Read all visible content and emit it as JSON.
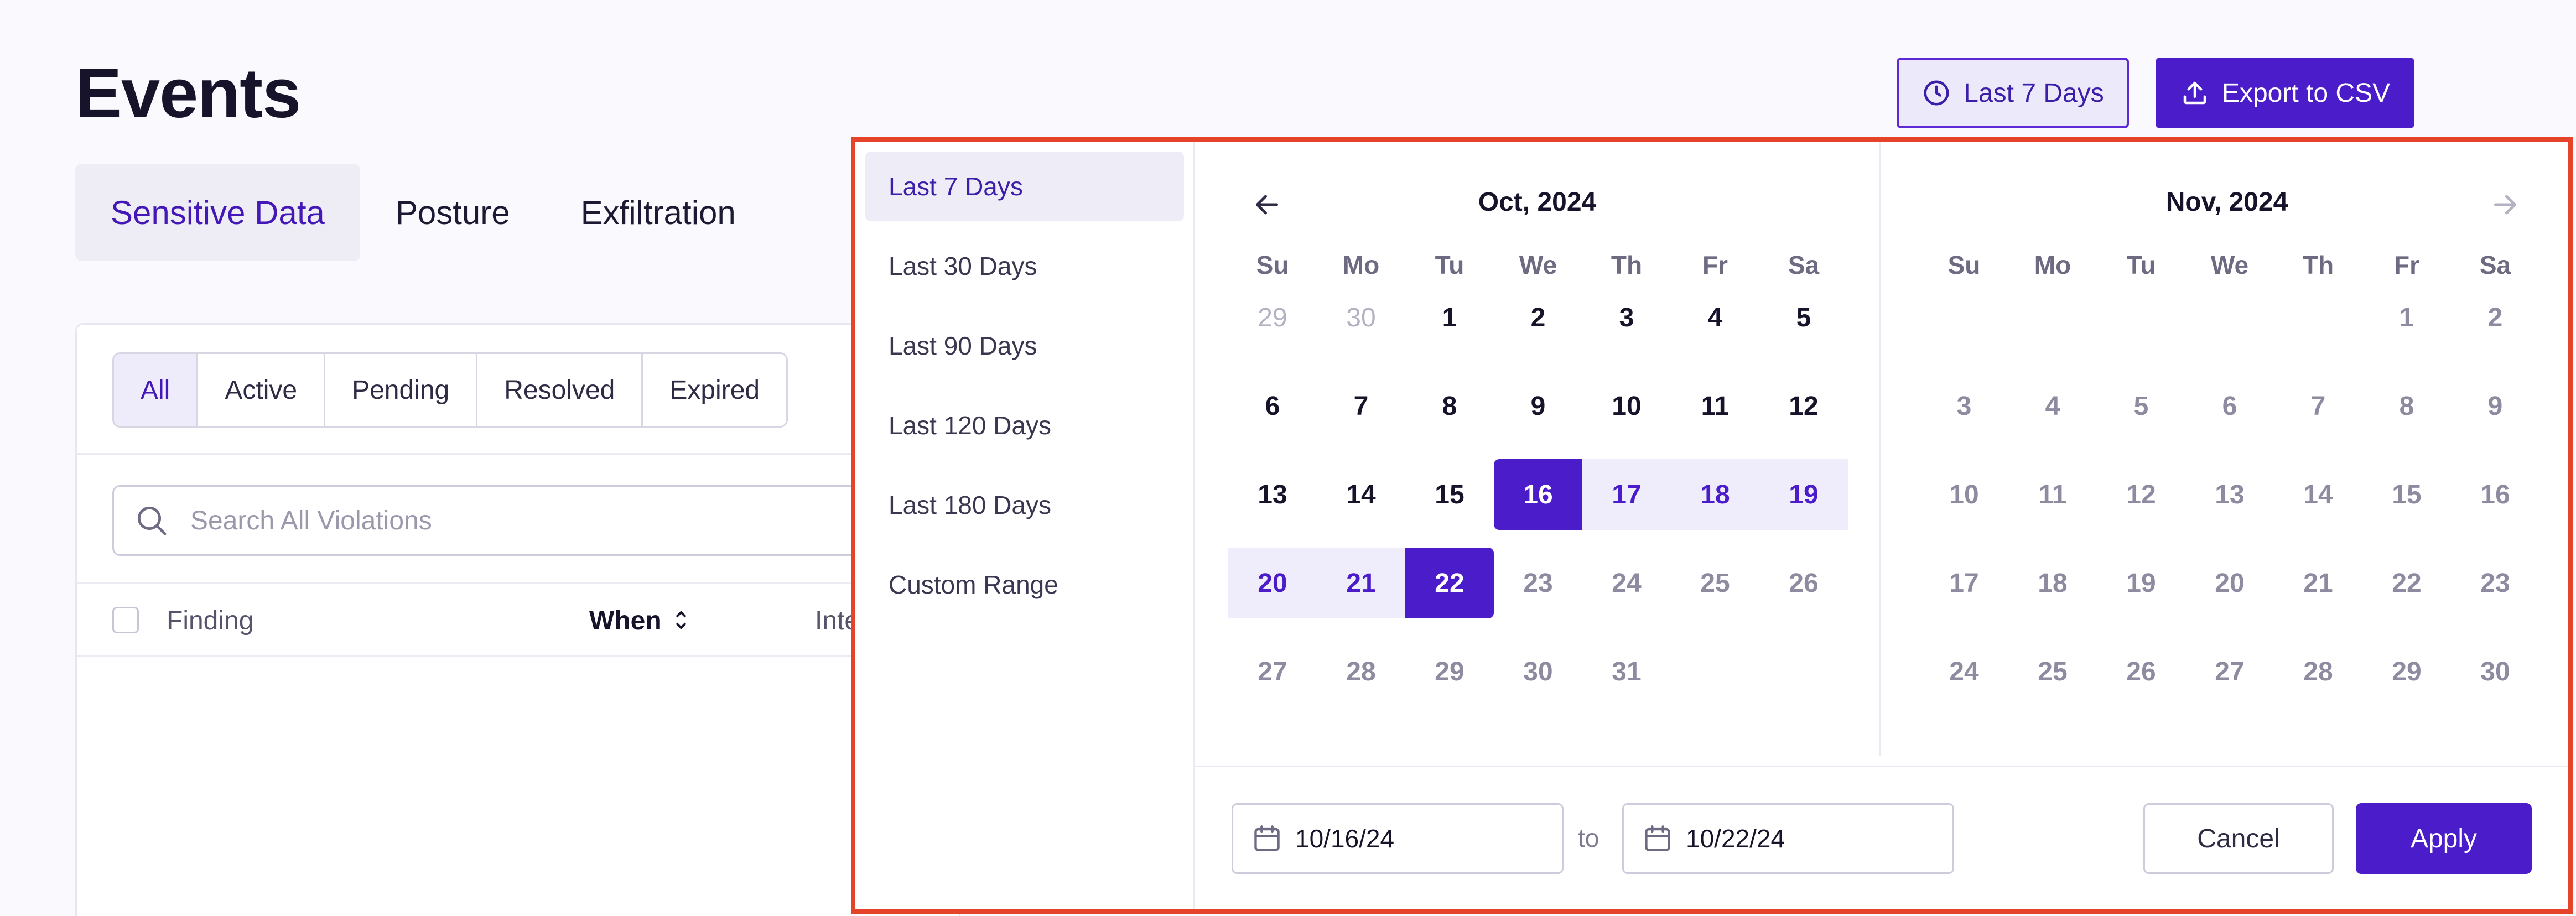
{
  "page": {
    "title": "Events"
  },
  "header": {
    "range_button_label": "Last 7 Days",
    "export_button_label": "Export to CSV"
  },
  "tabs": [
    {
      "label": "Sensitive Data",
      "active": true
    },
    {
      "label": "Posture",
      "active": false
    },
    {
      "label": "Exfiltration",
      "active": false
    }
  ],
  "filters": [
    {
      "label": "All",
      "active": true
    },
    {
      "label": "Active",
      "active": false
    },
    {
      "label": "Pending",
      "active": false
    },
    {
      "label": "Resolved",
      "active": false
    },
    {
      "label": "Expired",
      "active": false
    }
  ],
  "search": {
    "placeholder": "Search All Violations",
    "value": ""
  },
  "table": {
    "columns": [
      "Finding",
      "When",
      "Inte"
    ]
  },
  "date_picker": {
    "presets": [
      {
        "label": "Last 7 Days",
        "active": true
      },
      {
        "label": "Last 30 Days",
        "active": false
      },
      {
        "label": "Last 90 Days",
        "active": false
      },
      {
        "label": "Last 120 Days",
        "active": false
      },
      {
        "label": "Last 180 Days",
        "active": false
      },
      {
        "label": "Custom Range",
        "active": false
      }
    ],
    "weekdays": [
      "Su",
      "Mo",
      "Tu",
      "We",
      "Th",
      "Fr",
      "Sa"
    ],
    "months": [
      {
        "title": "Oct, 2024",
        "weeks": [
          [
            "29",
            "30",
            "1",
            "2",
            "3",
            "4",
            "5"
          ],
          [
            "6",
            "7",
            "8",
            "9",
            "10",
            "11",
            "12"
          ],
          [
            "13",
            "14",
            "15",
            "16",
            "17",
            "18",
            "19"
          ],
          [
            "20",
            "21",
            "22",
            "23",
            "24",
            "25",
            "26"
          ],
          [
            "27",
            "28",
            "29",
            "30",
            "31",
            "",
            ""
          ]
        ]
      },
      {
        "title": "Nov, 2024",
        "weeks": [
          [
            "",
            "",
            "",
            "",
            "",
            "1",
            "2"
          ],
          [
            "3",
            "4",
            "5",
            "6",
            "7",
            "8",
            "9"
          ],
          [
            "10",
            "11",
            "12",
            "13",
            "14",
            "15",
            "16"
          ],
          [
            "17",
            "18",
            "19",
            "20",
            "21",
            "22",
            "23"
          ],
          [
            "24",
            "25",
            "26",
            "27",
            "28",
            "29",
            "30"
          ]
        ]
      }
    ],
    "start_date": "10/16/24",
    "end_date": "10/22/24",
    "to_label": "to",
    "cancel_label": "Cancel",
    "apply_label": "Apply"
  },
  "colors": {
    "accent": "#4b1cc9",
    "range_highlight": "#efedfb",
    "popover_outline": "#e5432a"
  }
}
